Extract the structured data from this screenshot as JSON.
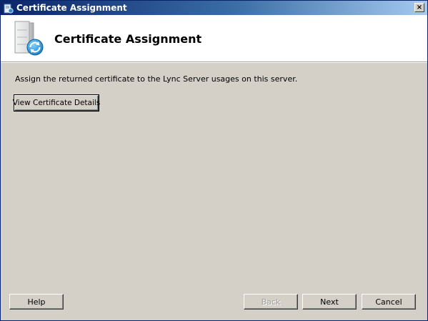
{
  "window": {
    "title": "Certificate Assignment",
    "icon": "certificate-server-icon",
    "close_label": "×"
  },
  "header": {
    "title": "Certificate Assignment",
    "icon": "server-sync-icon"
  },
  "body": {
    "instruction": "Assign the returned certificate to the Lync Server usages on this server.",
    "view_details_label": "View Certificate Details"
  },
  "footer": {
    "help_label": "Help",
    "back_label": "Back",
    "back_enabled": false,
    "next_label": "Next",
    "cancel_label": "Cancel"
  },
  "colors": {
    "titlebar_start": "#0a246a",
    "titlebar_end": "#a6caf0",
    "dialog_background": "#d4d0c8",
    "header_background": "#ffffff"
  }
}
